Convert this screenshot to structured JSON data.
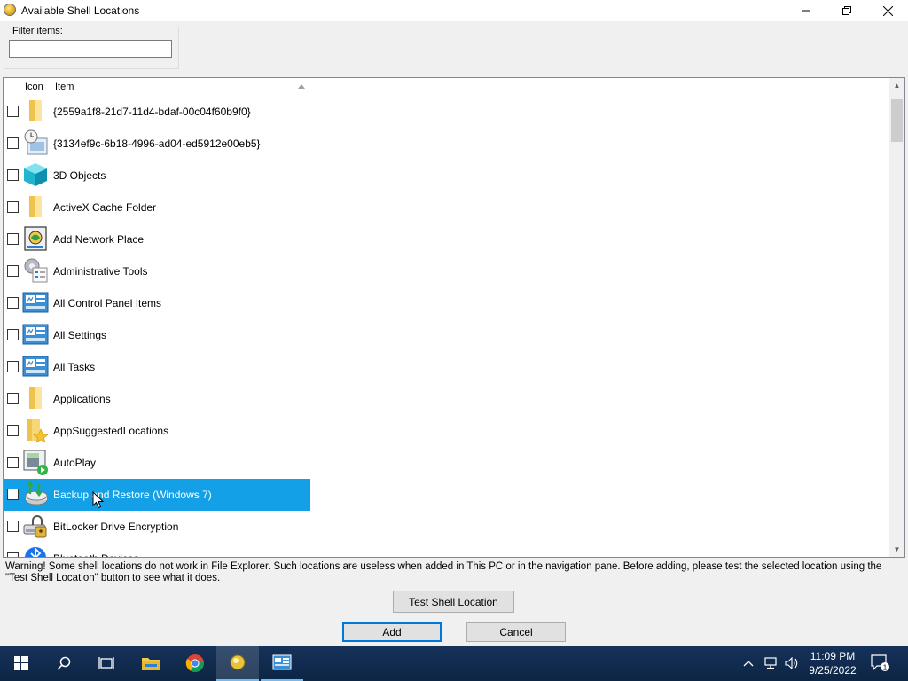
{
  "window": {
    "title": "Available Shell Locations",
    "minimize_icon": "minimize-icon",
    "maximize_icon": "restore-icon",
    "close_icon": "close-icon"
  },
  "filter": {
    "label": "Filter items:",
    "value": "",
    "placeholder": ""
  },
  "list": {
    "columns": [
      "Icon",
      "Item"
    ],
    "sort": "ascending",
    "rows": [
      {
        "label": "{2559a1f8-21d7-11d4-bdaf-00c04f60b9f0}",
        "icon": "folder-icon",
        "checked": false,
        "selected": false
      },
      {
        "label": "{3134ef9c-6b18-4996-ad04-ed5912e00eb5}",
        "icon": "clock-window-icon",
        "checked": false,
        "selected": false
      },
      {
        "label": "3D Objects",
        "icon": "cube-icon",
        "checked": false,
        "selected": false
      },
      {
        "label": "ActiveX Cache Folder",
        "icon": "folder-icon",
        "checked": false,
        "selected": false
      },
      {
        "label": "Add Network Place",
        "icon": "network-place-icon",
        "checked": false,
        "selected": false
      },
      {
        "label": "Administrative Tools",
        "icon": "admin-tools-icon",
        "checked": false,
        "selected": false
      },
      {
        "label": "All Control Panel Items",
        "icon": "control-panel-icon",
        "checked": false,
        "selected": false
      },
      {
        "label": "All Settings",
        "icon": "control-panel-icon",
        "checked": false,
        "selected": false
      },
      {
        "label": "All Tasks",
        "icon": "control-panel-icon",
        "checked": false,
        "selected": false
      },
      {
        "label": "Applications",
        "icon": "folder-icon",
        "checked": false,
        "selected": false
      },
      {
        "label": "AppSuggestedLocations",
        "icon": "folder-star-icon",
        "checked": false,
        "selected": false
      },
      {
        "label": "AutoPlay",
        "icon": "autoplay-icon",
        "checked": false,
        "selected": false
      },
      {
        "label": "Backup and Restore (Windows 7)",
        "icon": "backup-restore-icon",
        "checked": false,
        "selected": true
      },
      {
        "label": "BitLocker Drive Encryption",
        "icon": "bitlocker-icon",
        "checked": false,
        "selected": false
      },
      {
        "label": "Bluetooth Devices",
        "icon": "bluetooth-icon",
        "checked": false,
        "selected": false
      }
    ]
  },
  "warning": "Warning! Some shell locations do not work in File Explorer. Such locations are useless when added in This PC or in the navigation pane. Before adding, please test the selected location using the \"Test Shell Location\" button to see what it does.",
  "buttons": {
    "test": "Test Shell Location",
    "add": "Add",
    "cancel": "Cancel"
  },
  "taskbar": {
    "items": [
      "start-icon",
      "search-icon",
      "task-view-icon",
      "file-explorer-icon",
      "chrome-icon",
      "winaero-tweaker-icon",
      "control-panel-icon"
    ],
    "time": "11:09 PM",
    "date": "9/25/2022",
    "notification_count": "1"
  },
  "colors": {
    "selection": "#14a0e6",
    "accent": "#0078d7",
    "taskbar": "#16325a"
  }
}
